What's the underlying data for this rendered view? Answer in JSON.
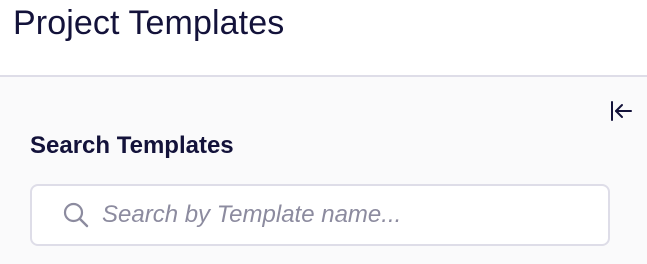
{
  "header": {
    "title": "Project Templates"
  },
  "sidebar": {
    "collapse_icon": "collapse-left-icon",
    "search": {
      "label": "Search Templates",
      "placeholder": "Search by Template name...",
      "value": "",
      "icon": "search-icon"
    }
  },
  "colors": {
    "text_primary": "#13123a",
    "placeholder": "#8c8b9f",
    "border": "#dedde8",
    "panel_bg": "#fafafb"
  }
}
